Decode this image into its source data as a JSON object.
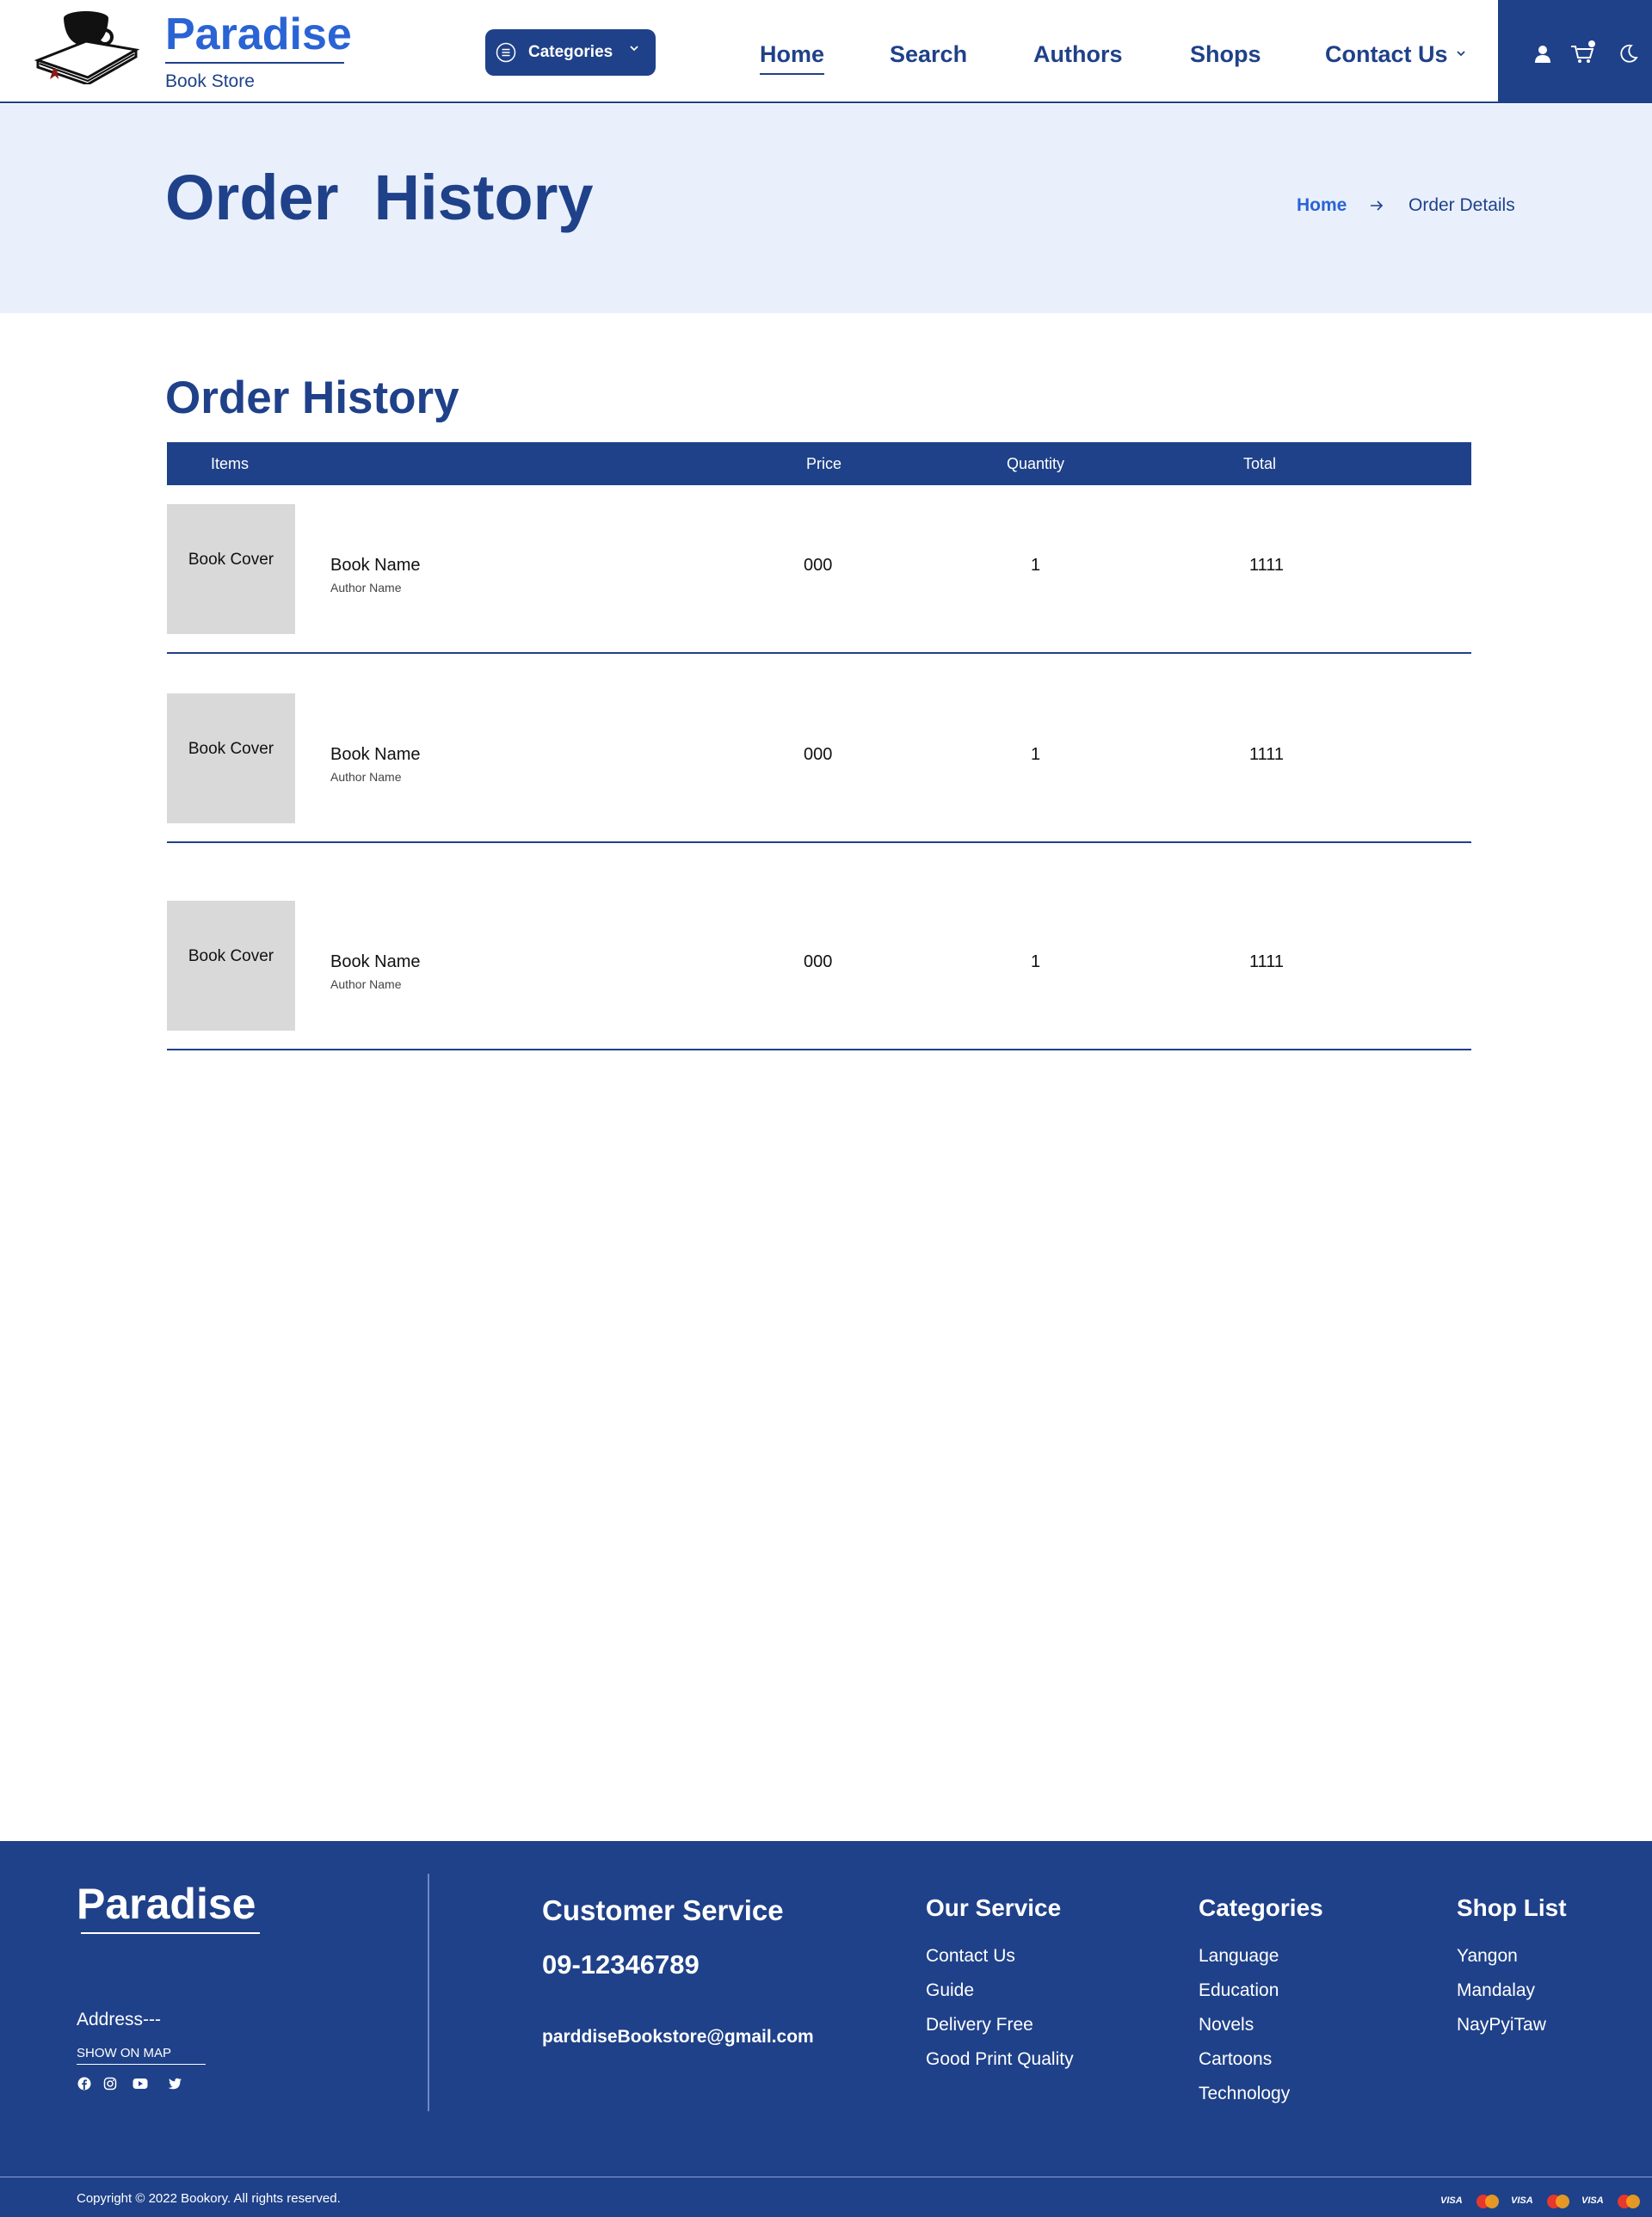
{
  "header": {
    "brand_name": "Paradise",
    "brand_sub": "Book Store",
    "categories_label": "Categories",
    "nav": [
      {
        "label": "Home",
        "active": true
      },
      {
        "label": "Search"
      },
      {
        "label": "Authors"
      },
      {
        "label": "Shops"
      },
      {
        "label": "Contact Us",
        "has_dropdown": true
      }
    ],
    "icons": [
      "user-icon",
      "cart-icon",
      "moon-icon"
    ]
  },
  "hero": {
    "title": "Order  History",
    "breadcrumb": {
      "home": "Home",
      "current": "Order Details"
    }
  },
  "orders": {
    "title": "Order History",
    "columns": {
      "items": "Items",
      "price": "Price",
      "quantity": "Quantity",
      "total": "Total"
    },
    "rows": [
      {
        "cover": "Book Cover",
        "name": "Book Name",
        "author": "Author Name",
        "price": "000",
        "quantity": "1",
        "total": "1111"
      },
      {
        "cover": "Book Cover",
        "name": "Book Name",
        "author": "Author Name",
        "price": "000",
        "quantity": "1",
        "total": "1111"
      },
      {
        "cover": "Book Cover",
        "name": "Book Name",
        "author": "Author Name",
        "price": "000",
        "quantity": "1",
        "total": "1111"
      }
    ]
  },
  "footer": {
    "brand": "Paradise",
    "address": "Address---",
    "show_on_map": "SHOW ON MAP",
    "social_icons": [
      "facebook-icon",
      "instagram-icon",
      "youtube-icon",
      "twitter-icon"
    ],
    "customer_service": {
      "title": "Customer Service",
      "phone": "09-12346789",
      "email": "parddiseBookstore@gmail.com"
    },
    "our_service": {
      "title": "Our Service",
      "items": [
        "Contact Us",
        "Guide",
        "Delivery Free",
        "Good Print Quality"
      ]
    },
    "categories": {
      "title": "Categories",
      "items": [
        "Language",
        "Education",
        "Novels",
        "Cartoons",
        "Technology"
      ]
    },
    "shop_list": {
      "title": "Shop List",
      "items": [
        "Yangon",
        "Mandalay",
        "NayPyiTaw"
      ]
    },
    "copyright": "Copyright © 2022 Bookory. All rights reserved.",
    "payment_icons": [
      "visa-icon",
      "mastercard-icon",
      "visa-icon",
      "mastercard-icon",
      "visa-icon",
      "mastercard-icon"
    ],
    "visa_label": "VISA"
  },
  "colors": {
    "primary": "#1f4189",
    "accent": "#2a63d4",
    "hero_bg": "#e9f0fc",
    "cover_bg": "#d9d9d9"
  }
}
